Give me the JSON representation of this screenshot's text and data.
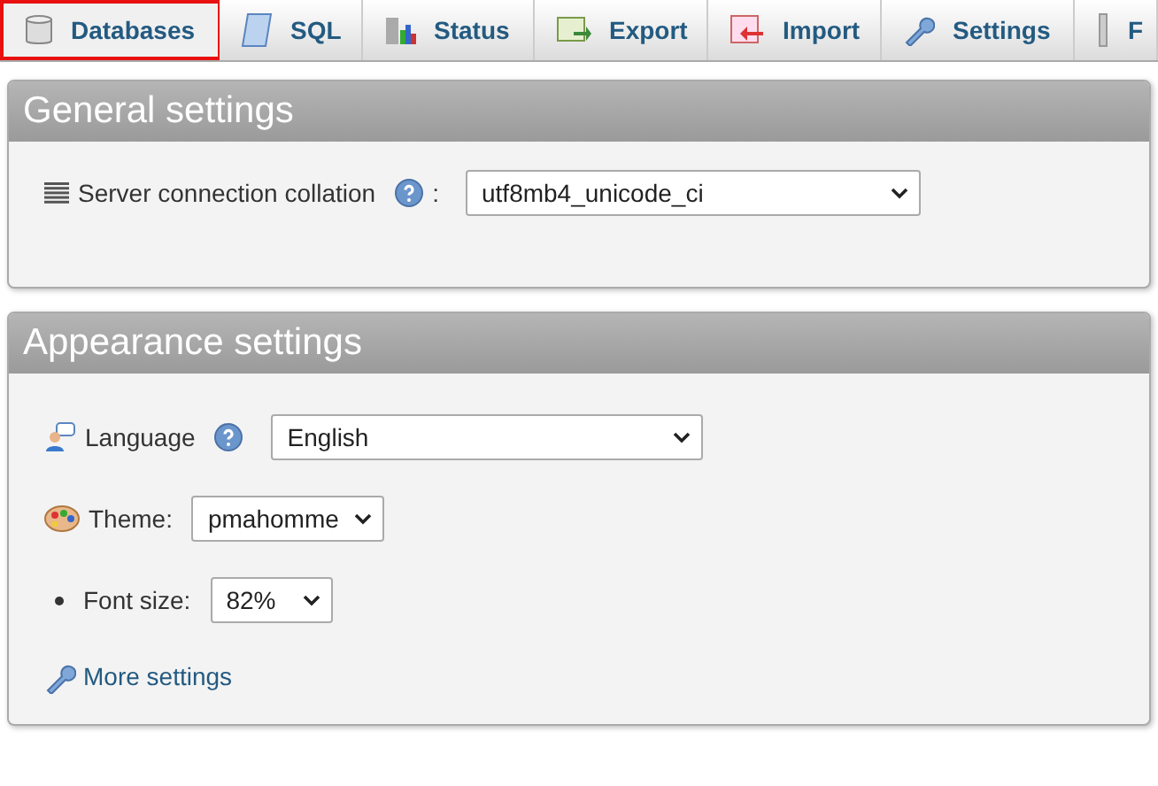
{
  "tabs": [
    {
      "label": "Databases",
      "kind": "database",
      "selected": true
    },
    {
      "label": "SQL",
      "kind": "sql",
      "selected": false
    },
    {
      "label": "Status",
      "kind": "status",
      "selected": false
    },
    {
      "label": "Export",
      "kind": "export",
      "selected": false
    },
    {
      "label": "Import",
      "kind": "import",
      "selected": false
    },
    {
      "label": "Settings",
      "kind": "settings",
      "selected": false
    },
    {
      "label": "F",
      "kind": "more",
      "selected": false
    }
  ],
  "general_settings": {
    "title": "General settings",
    "fields": [
      {
        "kind": "collation",
        "label": "Server connection collation",
        "help": true,
        "suffix": ":",
        "value": "utf8mb4_unicode_ci"
      }
    ]
  },
  "appearance_settings": {
    "title": "Appearance settings",
    "fields": [
      {
        "kind": "language",
        "label": "Language",
        "help": true,
        "value": "English"
      },
      {
        "kind": "theme",
        "label": "Theme:",
        "help": false,
        "value": "pmahomme"
      },
      {
        "kind": "fontsize",
        "label": "Font size:",
        "help": false,
        "value": "82%"
      }
    ],
    "link": {
      "label": "More settings"
    }
  }
}
